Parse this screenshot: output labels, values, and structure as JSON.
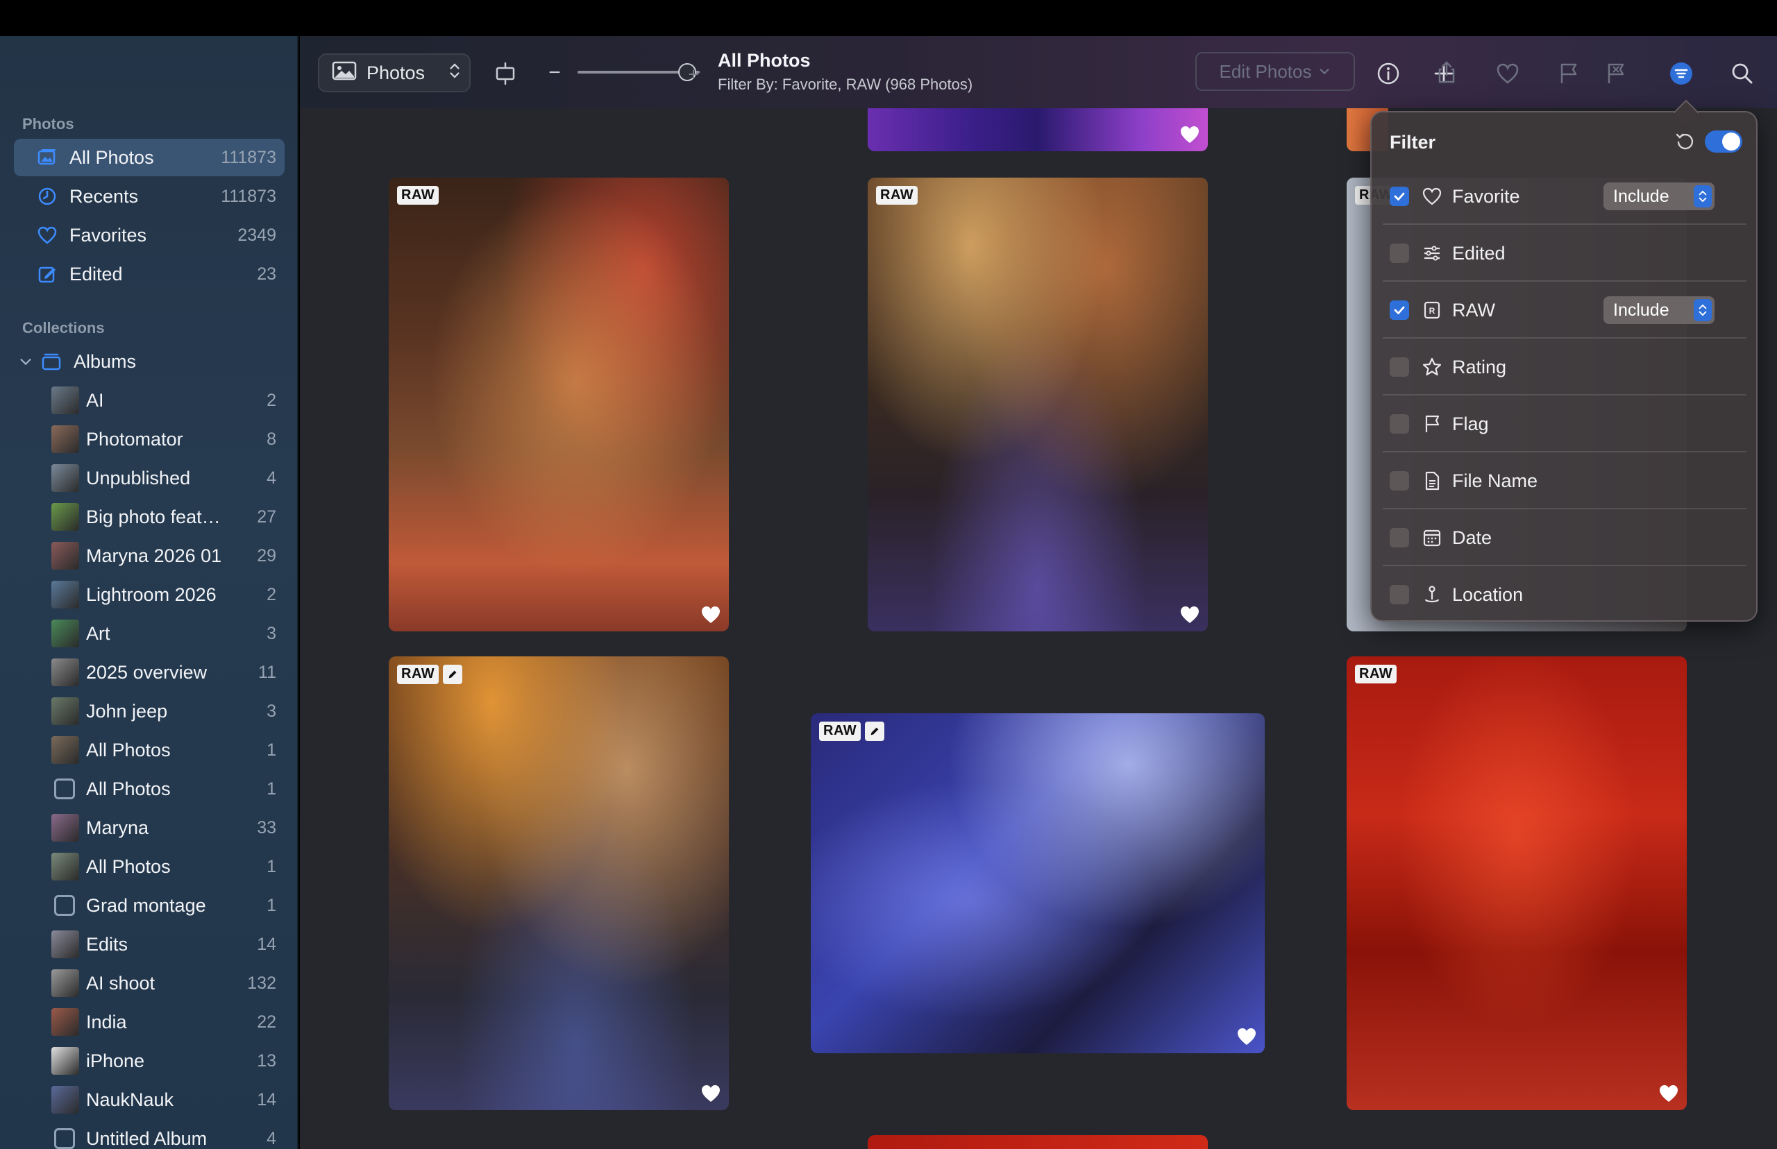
{
  "sidebar": {
    "section_photos": "Photos",
    "photos_items": [
      {
        "label": "All Photos",
        "count": "111873"
      },
      {
        "label": "Recents",
        "count": "111873"
      },
      {
        "label": "Favorites",
        "count": "2349"
      },
      {
        "label": "Edited",
        "count": "23"
      }
    ],
    "section_collections": "Collections",
    "albums_label": "Albums",
    "albums": [
      {
        "label": "AI",
        "count": "2"
      },
      {
        "label": "Photomator",
        "count": "8"
      },
      {
        "label": "Unpublished",
        "count": "4"
      },
      {
        "label": "Big photo featur...",
        "count": "27"
      },
      {
        "label": "Maryna 2026 01",
        "count": "29"
      },
      {
        "label": "Lightroom 2026",
        "count": "2"
      },
      {
        "label": "Art",
        "count": "3"
      },
      {
        "label": "2025 overview",
        "count": "11"
      },
      {
        "label": "John jeep",
        "count": "3"
      },
      {
        "label": "All Photos",
        "count": "1"
      },
      {
        "label": "All Photos",
        "count": "1"
      },
      {
        "label": "Maryna",
        "count": "33"
      },
      {
        "label": "All Photos",
        "count": "1"
      },
      {
        "label": "Grad montage",
        "count": "1"
      },
      {
        "label": "Edits",
        "count": "14"
      },
      {
        "label": "AI shoot",
        "count": "132"
      },
      {
        "label": "India",
        "count": "22"
      },
      {
        "label": "iPhone",
        "count": "13"
      },
      {
        "label": "NaukNauk",
        "count": "14"
      },
      {
        "label": "Untitled Album",
        "count": "4"
      }
    ]
  },
  "toolbar": {
    "library_label": "Photos",
    "zoom_minus": "−",
    "zoom_plus": "+",
    "zoom_level": 0.9,
    "title": "All Photos",
    "subtitle": "Filter By: Favorite, RAW (968 Photos)",
    "edit_label": "Edit Photos"
  },
  "photos": [
    {
      "badge": "RAW",
      "edited": false,
      "favorite": true,
      "tone": "orange"
    },
    {
      "badge": "RAW",
      "edited": false,
      "favorite": true,
      "tone": "amber"
    },
    {
      "badge": "RAW",
      "edited": false,
      "favorite": true,
      "tone": "grey"
    },
    {
      "badge": "RAW",
      "edited": true,
      "favorite": true,
      "tone": "amber"
    },
    {
      "badge": "RAW",
      "edited": true,
      "favorite": true,
      "tone": "blue"
    },
    {
      "badge": "RAW",
      "edited": false,
      "favorite": true,
      "tone": "red"
    }
  ],
  "filter": {
    "title": "Filter",
    "enabled": true,
    "rows": [
      {
        "label": "Favorite",
        "checked": true,
        "mode": "Include",
        "icon": "heart-icon"
      },
      {
        "label": "Edited",
        "checked": false,
        "icon": "sliders-icon"
      },
      {
        "label": "RAW",
        "checked": true,
        "mode": "Include",
        "icon": "raw-icon"
      },
      {
        "label": "Rating",
        "checked": false,
        "icon": "star-icon"
      },
      {
        "label": "Flag",
        "checked": false,
        "icon": "flag-icon"
      },
      {
        "label": "File Name",
        "checked": false,
        "icon": "document-icon"
      },
      {
        "label": "Date",
        "checked": false,
        "icon": "calendar-icon"
      },
      {
        "label": "Location",
        "checked": false,
        "icon": "location-icon"
      }
    ]
  },
  "colors": {
    "accent": "#2f6fd9",
    "selected_sidebar": "#3a5474"
  }
}
